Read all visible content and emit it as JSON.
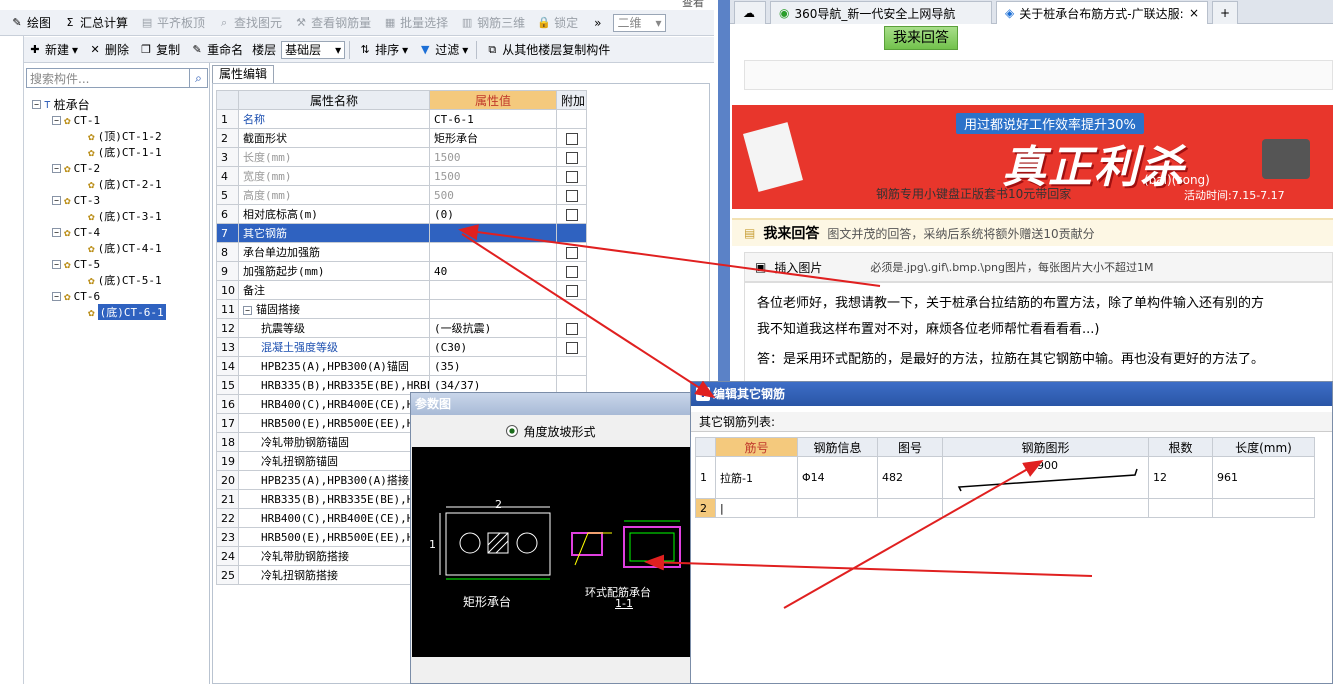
{
  "toolbar1": {
    "items": [
      "绘图",
      "汇总计算",
      "平齐板顶",
      "查找图元",
      "查看钢筋量",
      "批量选择",
      "钢筋三维",
      "锁定"
    ],
    "combo": "二维",
    "overflow": "»",
    "top_right": "查看"
  },
  "toolbar2": {
    "items": [
      "新建",
      "删除",
      "复制",
      "重命名",
      "楼层"
    ],
    "floor_combo": "基础层",
    "sort": "排序",
    "filter": "过滤",
    "copy_from": "从其他楼层复制构件"
  },
  "left": {
    "close_x": "×",
    "search_placeholder": "搜索构件...",
    "tree": {
      "root": "桩承台",
      "nodes": [
        {
          "label": "CT-1",
          "children": [
            "(顶)CT-1-2",
            "(底)CT-1-1"
          ]
        },
        {
          "label": "CT-2",
          "children": [
            "(底)CT-2-1"
          ]
        },
        {
          "label": "CT-3",
          "children": [
            "(底)CT-3-1"
          ]
        },
        {
          "label": "CT-4",
          "children": [
            "(底)CT-4-1"
          ]
        },
        {
          "label": "CT-5",
          "children": [
            "(底)CT-5-1"
          ]
        },
        {
          "label": "CT-6",
          "children": [
            "(底)CT-6-1"
          ]
        }
      ]
    }
  },
  "props": {
    "tab": "属性编辑",
    "headers": [
      "属性名称",
      "属性值",
      "附加"
    ],
    "rows": [
      {
        "n": "1",
        "name": "名称",
        "value": "CT-6-1",
        "cb": false
      },
      {
        "n": "2",
        "name": "截面形状",
        "value": "矩形承台",
        "cb": true
      },
      {
        "n": "3",
        "name": "长度(mm)",
        "value": "1500",
        "cb": true
      },
      {
        "n": "4",
        "name": "宽度(mm)",
        "value": "1500",
        "cb": true
      },
      {
        "n": "5",
        "name": "高度(mm)",
        "value": "500",
        "cb": true
      },
      {
        "n": "6",
        "name": "相对底标高(m)",
        "value": "(0)",
        "cb": true
      },
      {
        "n": "7",
        "name": "其它钢筋",
        "value": "",
        "cb": false
      },
      {
        "n": "8",
        "name": "承台单边加强筋",
        "value": "",
        "cb": true
      },
      {
        "n": "9",
        "name": "加强筋起步(mm)",
        "value": "40",
        "cb": true
      },
      {
        "n": "10",
        "name": "备注",
        "value": "",
        "cb": true
      },
      {
        "n": "11",
        "name": "锚固搭接",
        "value": "",
        "cb": false
      },
      {
        "n": "12",
        "name": "抗震等级",
        "value": "(一级抗震)",
        "cb": true
      },
      {
        "n": "13",
        "name": "混凝土强度等级",
        "value": "(C30)",
        "cb": true
      },
      {
        "n": "14",
        "name": "HPB235(A),HPB300(A)锚固",
        "value": "(35)",
        "cb": false
      },
      {
        "n": "15",
        "name": "HRB335(B),HRB335E(BE),HRBF",
        "value": "(34/37)",
        "cb": false
      },
      {
        "n": "16",
        "name": "HRB400(C),HRB400E(CE),H",
        "value": "",
        "cb": false
      },
      {
        "n": "17",
        "name": "HRB500(E),HRB500E(EE),H",
        "value": "",
        "cb": false
      },
      {
        "n": "18",
        "name": "冷轧带肋钢筋锚固",
        "value": "",
        "cb": false
      },
      {
        "n": "19",
        "name": "冷轧扭钢筋锚固",
        "value": "",
        "cb": false
      },
      {
        "n": "20",
        "name": "HPB235(A),HPB300(A)搭接",
        "value": "",
        "cb": false
      },
      {
        "n": "21",
        "name": "HRB335(B),HRB335E(BE),H",
        "value": "",
        "cb": false
      },
      {
        "n": "22",
        "name": "HRB400(C),HRB400E(CE),H",
        "value": "",
        "cb": false
      },
      {
        "n": "23",
        "name": "HRB500(E),HRB500E(EE),H",
        "value": "",
        "cb": false
      },
      {
        "n": "24",
        "name": "冷轧带肋钢筋搭接",
        "value": "",
        "cb": false
      },
      {
        "n": "25",
        "name": "冷轧扭钢筋搭接",
        "value": "",
        "cb": false
      }
    ]
  },
  "param": {
    "title": "参数图",
    "radio": "角度放坡形式",
    "caption_rect": "矩形承台",
    "caption_ring": "环式配筋承台",
    "caption_sec": "1-1",
    "dim_2": "2",
    "dim_1": "1"
  },
  "browser": {
    "tabs": [
      "360导航_新一代安全上网导航",
      "关于桩承台布筋方式-广联达服:"
    ],
    "plus": "+",
    "answer_btn": "我来回答",
    "banner": {
      "top": "用过都说好工作效率提升30%",
      "big": "真正利杀",
      "note": "(bai)(song)",
      "sub": "钢筋专用小键盘正版套书10元带回家",
      "date": "活动时间:7.15-7.17"
    },
    "answer_title": "我来回答",
    "answer_desc": "图文并茂的回答，采纳后系统将额外赠送10贡献分",
    "insert_pic": "插入图片",
    "pic_note": "必须是.jpg\\.gif\\.bmp.\\png图片，每张图片大小不超过1M",
    "q1": "各位老师好，我想请教一下，关于桩承台拉结筋的布置方法，除了单构件输入还有别的方",
    "q2": "我不知道我这样布置对不对，麻烦各位老师帮忙看看看看...)",
    "a1": "答：是采用环式配筋的，是最好的方法，拉筋在其它钢筋中输。再也没有更好的方法了。"
  },
  "dialog": {
    "title": "编辑其它钢筋",
    "list_label": "其它钢筋列表:",
    "headers": [
      "筋号",
      "钢筋信息",
      "图号",
      "钢筋图形",
      "根数",
      "长度(mm)"
    ],
    "rows": [
      {
        "n": "1",
        "name": "拉筋-1",
        "info": "Φ14",
        "fig": "482",
        "shape": "900",
        "count": "12",
        "len": "961"
      },
      {
        "n": "2",
        "name": "|",
        "info": "",
        "fig": "",
        "shape": "",
        "count": "",
        "len": ""
      }
    ]
  },
  "colors": {
    "accent": "#2f62c0",
    "arrow": "#e02020",
    "banner": "#e8362c",
    "header_val": "#f4c97d"
  }
}
